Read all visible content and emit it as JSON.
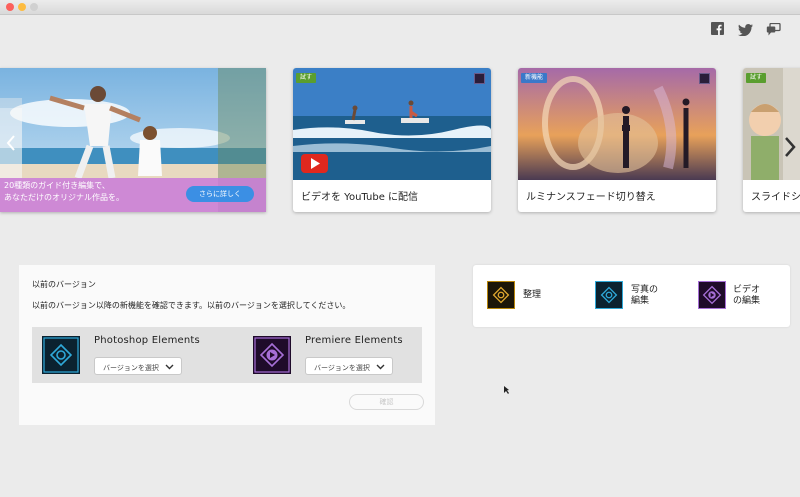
{
  "social": {
    "facebook": "facebook-icon",
    "twitter": "twitter-icon",
    "feedback": "feedback-icon"
  },
  "hero": {
    "caption_line1": "20種類のガイド付き編集で、",
    "caption_line2": "あなただけのオリジナル作品を。",
    "button": "さらに詳しく"
  },
  "cards": [
    {
      "badge": "試す",
      "badge_color": "#5a9e2f",
      "label": "ビデオを YouTube に配信"
    },
    {
      "badge": "新機能",
      "badge_color": "#3a78c9",
      "label": "ルミナンスフェード切り替え"
    },
    {
      "badge": "試す",
      "badge_color": "#5a9e2f",
      "label": "スライドショ"
    }
  ],
  "previous": {
    "title": "以前のバージョン",
    "description": "以前のバージョン以降の新機能を確認できます。以前のバージョンを選択してください。",
    "apps": [
      {
        "name": "Photoshop Elements",
        "select": "バージョンを選択"
      },
      {
        "name": "Premiere Elements",
        "select": "バージョンを選択"
      }
    ],
    "confirm": "確認"
  },
  "quick_actions": [
    {
      "label": "整理"
    },
    {
      "label_line1": "写真の",
      "label_line2": "編集"
    },
    {
      "label_line1": "ビデオ",
      "label_line2": "の編集"
    }
  ],
  "colors": {
    "accent_blue": "#3b8fe4",
    "hero_overlay": "#c97ad8"
  }
}
